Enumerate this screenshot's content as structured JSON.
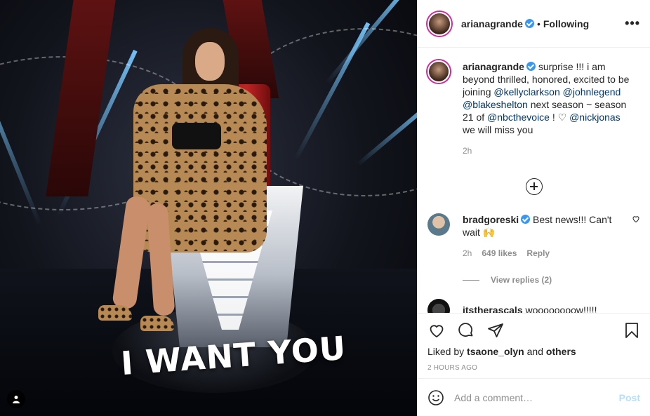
{
  "photo": {
    "overlay_text": "I WANT YOU",
    "tag_icon": "user-tag-icon"
  },
  "header": {
    "username": "arianagrande",
    "separator": "•",
    "follow_status": "Following",
    "more_label": "•••"
  },
  "caption": {
    "username": "arianagrande",
    "segments": [
      {
        "text": "surprise !!! i am beyond thrilled, honored, excited to be joining ",
        "type": "text"
      },
      {
        "text": "@kellyclarkson",
        "type": "mention"
      },
      {
        "text": " ",
        "type": "text"
      },
      {
        "text": "@johnlegend",
        "type": "mention"
      },
      {
        "text": " ",
        "type": "text"
      },
      {
        "text": "@blakeshelton",
        "type": "mention"
      },
      {
        "text": " next season ~ season 21 of ",
        "type": "text"
      },
      {
        "text": "@nbcthevoice",
        "type": "mention"
      },
      {
        "text": " ! ",
        "type": "text"
      },
      {
        "text": "♡",
        "type": "text"
      },
      {
        "text": " ",
        "type": "text"
      },
      {
        "text": "@nickjonas",
        "type": "mention"
      },
      {
        "text": " we will miss you",
        "type": "text"
      }
    ],
    "time": "2h"
  },
  "comments": [
    {
      "username": "bradgoreski",
      "text": "Best news!!! Can't wait 🙌",
      "time": "2h",
      "likes": "649 likes",
      "reply_label": "Reply",
      "view_replies": "View replies (2)"
    },
    {
      "username": "itstherascals",
      "text": "woooooooow!!!!!"
    }
  ],
  "actions": {
    "liked_prefix": "Liked by",
    "liked_user": "tsaone_olyn",
    "liked_and": "and",
    "liked_others": "others",
    "time_ago": "2 HOURS AGO"
  },
  "add_comment": {
    "placeholder": "Add a comment…",
    "post_label": "Post"
  },
  "colors": {
    "verified": "#3897f0",
    "mention": "#00376b",
    "post_disabled": "#b2dffc",
    "story_ring": "#d6249f"
  }
}
